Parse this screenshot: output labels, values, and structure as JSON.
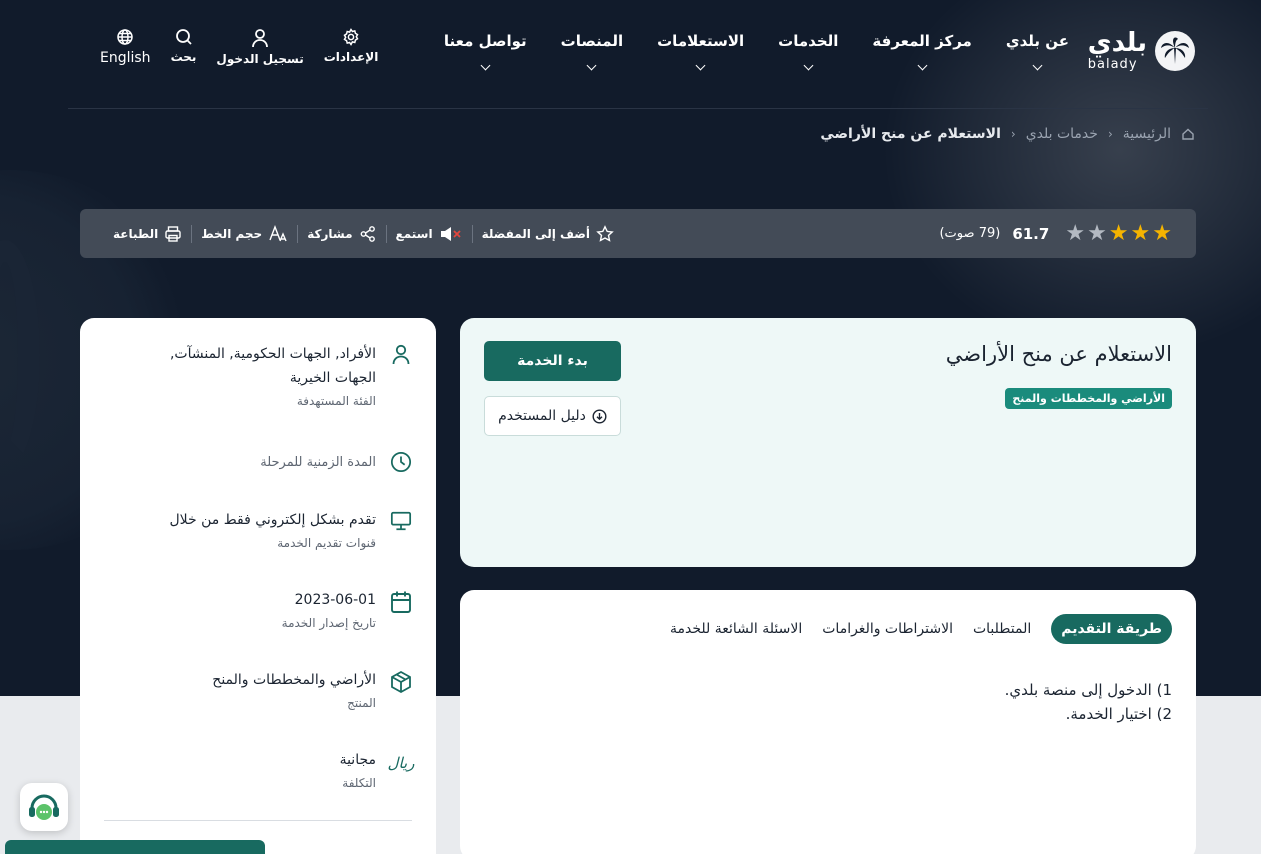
{
  "header": {
    "logo": {
      "ar": "بلدي",
      "en": "balady"
    },
    "menu": [
      {
        "label": "عن بلدي"
      },
      {
        "label": "مركز المعرفة"
      },
      {
        "label": "الخدمات"
      },
      {
        "label": "الاستعلامات"
      },
      {
        "label": "المنصات"
      },
      {
        "label": "تواصل معنا"
      }
    ],
    "utilities": {
      "language": "English",
      "search": "بحث",
      "login": "تسجيل الدخول",
      "settings": "الإعدادات"
    }
  },
  "breadcrumb": {
    "home": "الرئيسية",
    "parent": "خدمات بلدي",
    "current": "الاستعلام عن منح الأراضي"
  },
  "toolbar": {
    "rating": {
      "stars_filled": 3,
      "stars_total": 5,
      "score": "61.7",
      "votes": "(79 صوت)"
    },
    "favorite": "أضف إلى المفضلة",
    "listen": "استمع",
    "share": "مشاركة",
    "font_size": "حجم الخط",
    "print": "الطباعة"
  },
  "service": {
    "title": "الاستعلام عن منح الأراضي",
    "category": "الأراضي والمخططات والمنح",
    "start_button": "بدء الخدمة",
    "guide_button": "دليل المستخدم"
  },
  "tabs": [
    {
      "label": "طريقة التقديم",
      "active": true
    },
    {
      "label": "المتطلبات",
      "active": false
    },
    {
      "label": "الاشتراطات والغرامات",
      "active": false
    },
    {
      "label": "الاسئلة الشائعة للخدمة",
      "active": false
    }
  ],
  "steps": [
    "1) الدخول إلى منصة بلدي.",
    "2) اختيار الخدمة."
  ],
  "info": {
    "audience": {
      "value_1": "الأفراد, الجهات الحكومية, المنشآت,",
      "value_2": "الجهات الخيرية",
      "label": "الفئة المستهدفة"
    },
    "duration": {
      "label": "المدة الزمنية للمرحلة"
    },
    "channels": {
      "value": "تقدم بشكل إلكتروني فقط من خلال",
      "label": "قنوات تقديم الخدمة"
    },
    "date": {
      "value": "2023-06-01",
      "label": "تاريخ إصدار الخدمة"
    },
    "product": {
      "value": "الأراضي والمخططات والمنح",
      "label": "المنتج"
    },
    "cost": {
      "value": "مجانية",
      "label": "التكلفة",
      "currency_symbol": "ريال"
    }
  },
  "colors": {
    "navy": "#111b2b",
    "teal": "#186a60",
    "chip": "#1a8b7c",
    "star": "#f5b400"
  },
  "icons": [
    "globe-icon",
    "search-icon",
    "user-icon",
    "gear-icon",
    "home-icon",
    "star-icon",
    "speaker-mute-icon",
    "share-icon",
    "font-size-icon",
    "printer-icon",
    "download-icon",
    "person-icon",
    "clock-icon",
    "monitor-icon",
    "calendar-icon",
    "box-icon",
    "riyal-icon",
    "support-headset-icon"
  ]
}
